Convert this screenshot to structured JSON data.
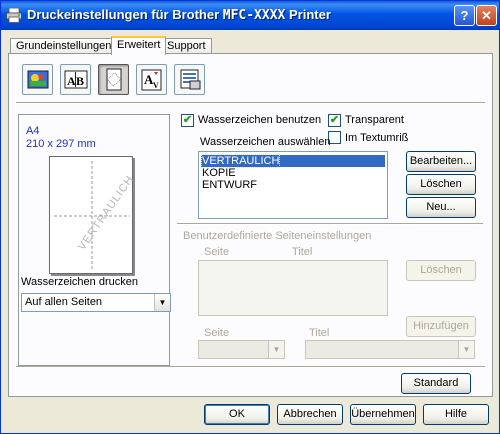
{
  "window": {
    "title_prefix": "Druckeinstellungen für Brother ",
    "title_model": "MFC-XXXX",
    "title_suffix": " Printer",
    "help_label": "?",
    "close_label": "✕"
  },
  "tabs": [
    {
      "label": "Grundeinstellungen",
      "active": false
    },
    {
      "label": "Erweitert",
      "active": true
    },
    {
      "label": "Support",
      "active": false
    }
  ],
  "toolbar_icons": [
    "color-settings-icon",
    "scaling-icon",
    "watermark-icon",
    "font-settings-icon",
    "device-options-icon"
  ],
  "preview": {
    "paper_size": "A4",
    "paper_dimensions": "210 x 297 mm",
    "watermark_text": "VERTRAULICH"
  },
  "print_watermark": {
    "label": "Wasserzeichen drucken",
    "selected": "Auf allen Seiten"
  },
  "watermark": {
    "use_label": "Wasserzeichen benutzen",
    "use_checked": true,
    "transparent_label": "Transparent",
    "transparent_checked": true,
    "outline_label": "Im Textumriß",
    "outline_checked": false,
    "select_label": "Wasserzeichen auswählen",
    "items": [
      "VERTRAULICH",
      "KOPIE",
      "ENTWURF"
    ],
    "selected_index": 0,
    "edit_button": "Bearbeiten...",
    "delete_button": "Löschen",
    "new_button": "Neu..."
  },
  "custom_settings": {
    "heading": "Benutzerdefinierte Seiteneinstellungen",
    "col_page": "Seite",
    "col_title": "Titel",
    "delete_button": "Löschen",
    "add_button": "Hinzufügen",
    "page_label": "Seite",
    "title_label": "Titel"
  },
  "footer": {
    "default_button": "Standard",
    "ok_button": "OK",
    "cancel_button": "Abbrechen",
    "apply_button": "Übernehmen",
    "help_button": "Hilfe"
  },
  "colors": {
    "titlebar": "#0054e3",
    "selection": "#316ac5",
    "paper_label": "#1f2fd1"
  }
}
